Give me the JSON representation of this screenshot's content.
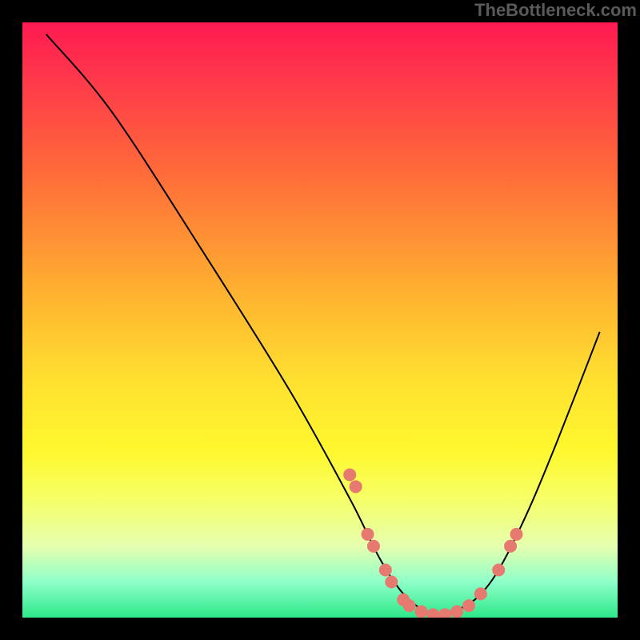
{
  "watermark": "TheBottleneck.com",
  "chart_data": {
    "type": "line",
    "title": "",
    "xlabel": "",
    "ylabel": "",
    "xlim": [
      0,
      100
    ],
    "ylim": [
      0,
      100
    ],
    "grid": false,
    "legend": false,
    "series": [
      {
        "name": "curve",
        "x": [
          4,
          15,
          30,
          45,
          55,
          60,
          64,
          68,
          72,
          76,
          80,
          85,
          90,
          97
        ],
        "y": [
          98,
          85,
          62,
          38,
          20,
          10,
          4,
          1,
          1,
          3,
          8,
          18,
          30,
          48
        ]
      }
    ],
    "markers": [
      {
        "x": 55,
        "y": 24
      },
      {
        "x": 56,
        "y": 22
      },
      {
        "x": 58,
        "y": 14
      },
      {
        "x": 59,
        "y": 12
      },
      {
        "x": 61,
        "y": 8
      },
      {
        "x": 62,
        "y": 6
      },
      {
        "x": 64,
        "y": 3
      },
      {
        "x": 65,
        "y": 2
      },
      {
        "x": 67,
        "y": 1
      },
      {
        "x": 69,
        "y": 0.5
      },
      {
        "x": 71,
        "y": 0.5
      },
      {
        "x": 73,
        "y": 1
      },
      {
        "x": 75,
        "y": 2
      },
      {
        "x": 77,
        "y": 4
      },
      {
        "x": 80,
        "y": 8
      },
      {
        "x": 82,
        "y": 12
      },
      {
        "x": 83,
        "y": 14
      }
    ]
  },
  "colors": {
    "marker": "#e77a70",
    "line": "#000000",
    "frame": "#000000"
  }
}
